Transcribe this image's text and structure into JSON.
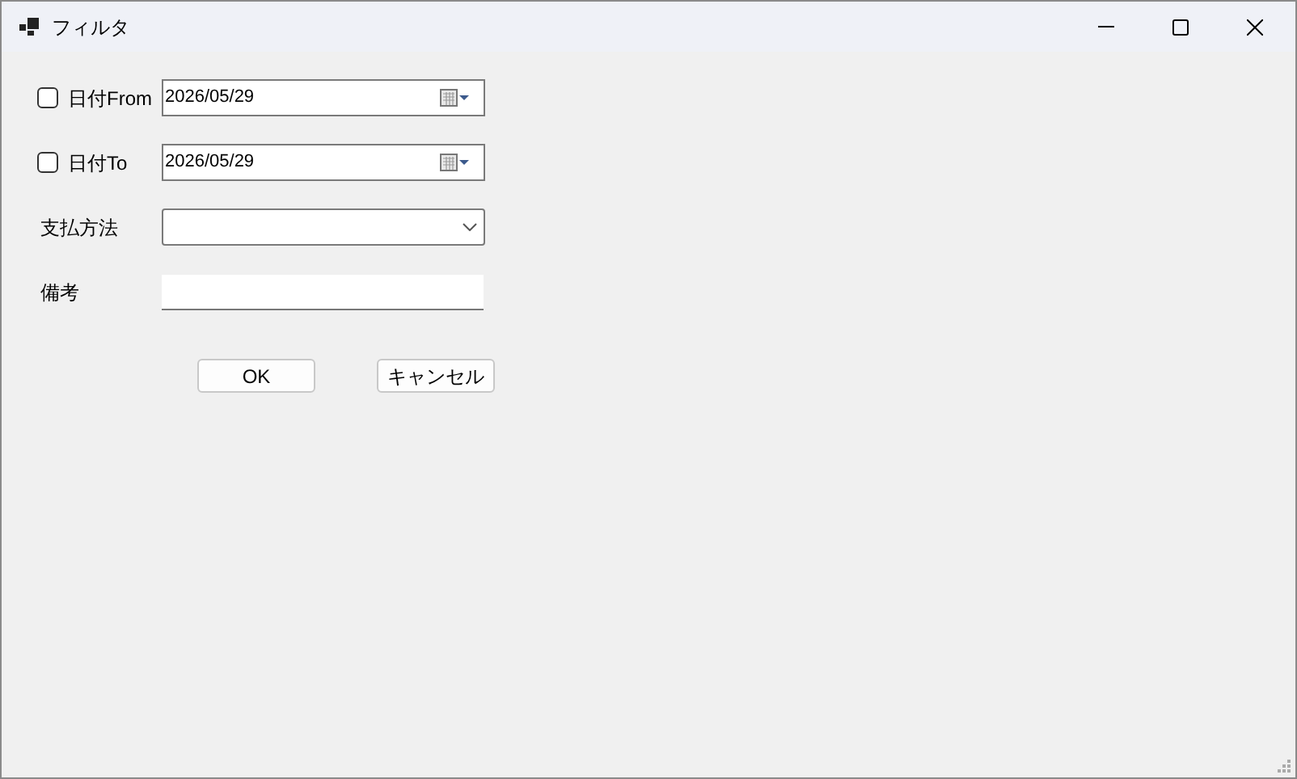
{
  "window": {
    "title": "フィルタ"
  },
  "fields": [
    {
      "kind": "date",
      "label": "日付From",
      "checked": false,
      "value": "2026/05/29"
    },
    {
      "kind": "date",
      "label": "日付To",
      "checked": false,
      "value": "2026/05/29"
    },
    {
      "kind": "combo",
      "label": "支払方法"
    },
    {
      "kind": "text",
      "label": "備考"
    }
  ],
  "buttons": [
    "OK",
    "キャンセル"
  ]
}
